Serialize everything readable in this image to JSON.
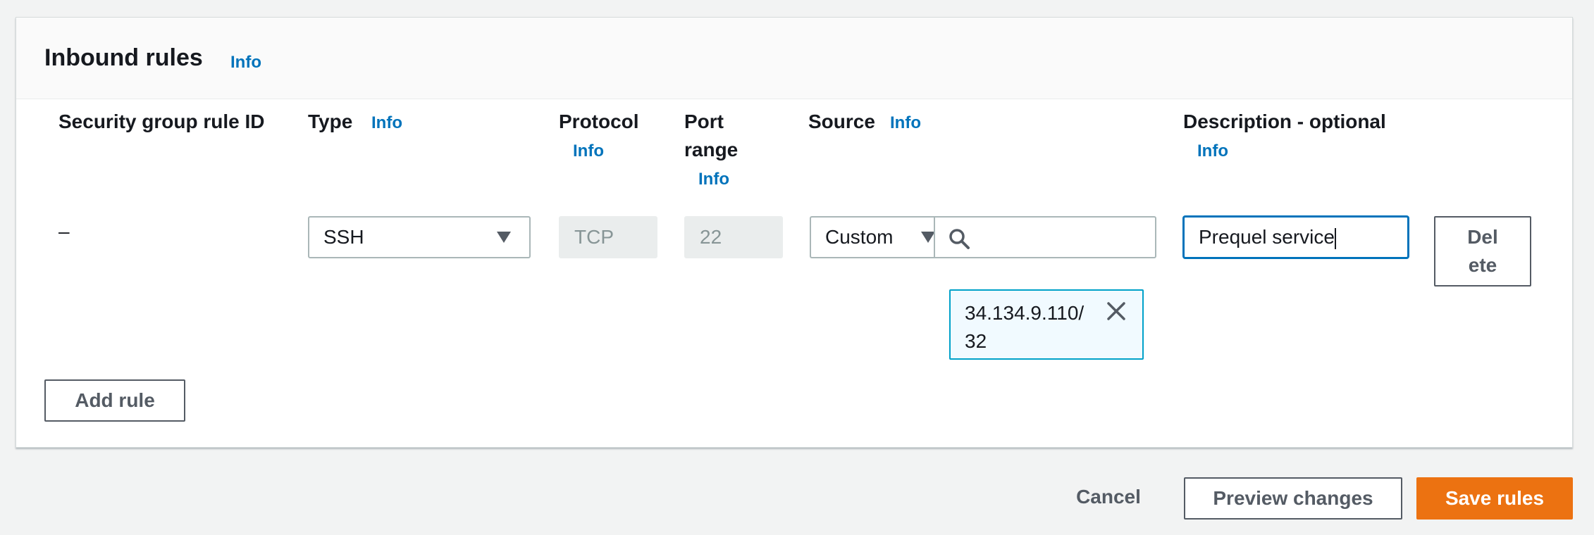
{
  "panel": {
    "title": "Inbound rules",
    "info": "Info"
  },
  "columns": {
    "rule_id": "Security group rule ID",
    "type": "Type",
    "type_info": "Info",
    "protocol": "Protocol",
    "protocol_info": "Info",
    "port_line1": "Port",
    "port_line2": "range",
    "port_info": "Info",
    "source": "Source",
    "source_info": "Info",
    "description": "Description - optional",
    "description_info": "Info"
  },
  "rule": {
    "rule_id": "–",
    "type_value": "SSH",
    "protocol_value": "TCP",
    "port_value": "22",
    "source_select": "Custom",
    "source_search": "",
    "source_token_line1": "34.134.9.110/",
    "source_token_line2": "32",
    "description_value": "Prequel service",
    "delete_line1": "Del",
    "delete_line2": "ete"
  },
  "actions": {
    "add_rule": "Add rule",
    "cancel": "Cancel",
    "preview": "Preview changes",
    "save": "Save rules"
  },
  "colors": {
    "accent_link": "#0073bb",
    "primary_button": "#ec7211",
    "token_border": "#00a1c9"
  },
  "icons": {
    "caret": "caret-down-icon",
    "search": "search-icon",
    "close": "close-icon"
  }
}
